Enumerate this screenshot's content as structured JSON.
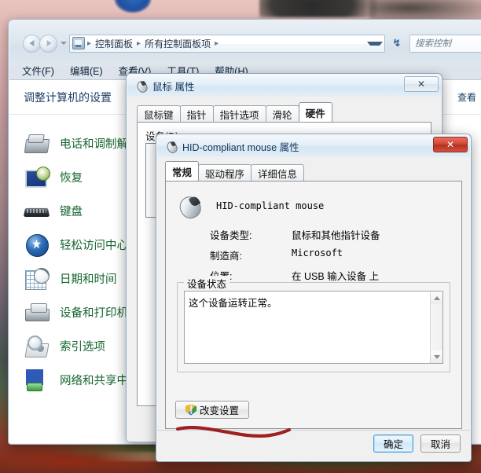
{
  "explorer": {
    "nav": {
      "back_icon": "back-arrow-icon",
      "forward_icon": "forward-arrow-icon",
      "recent_pages_icon": "chevron-down-icon",
      "address_icon": "control-panel-icon",
      "breadcrumbs": [
        "控制面板",
        "所有控制面板项"
      ],
      "breadcrumb_separator": "▸",
      "dropdown_icon": "chevron-down-icon",
      "refresh_icon": "refresh-icon",
      "refresh_glyph": "↯"
    },
    "search": {
      "placeholder": "搜索控制",
      "value": ""
    },
    "menu": [
      "文件(F)",
      "编辑(E)",
      "查看(V)",
      "工具(T)",
      "帮助(H)"
    ],
    "header": {
      "title": "调整计算机的设置",
      "view_by": "查看"
    },
    "items": [
      {
        "label": "电话和调制解",
        "icon": "phone-modem-icon"
      },
      {
        "label": "恢复",
        "icon": "recovery-icon"
      },
      {
        "label": "键盘",
        "icon": "keyboard-icon"
      },
      {
        "label": "轻松访问中心",
        "icon": "ease-of-access-icon"
      },
      {
        "label": "日期和时间",
        "icon": "date-time-icon"
      },
      {
        "label": "设备和打印机",
        "icon": "devices-printers-icon"
      },
      {
        "label": "索引选项",
        "icon": "indexing-options-icon"
      },
      {
        "label": "网络和共享中心",
        "icon": "network-sharing-icon"
      }
    ]
  },
  "mouse_properties": {
    "title": "鼠标 属性",
    "title_icon": "mouse-icon",
    "close_label": "✕",
    "tabs": [
      {
        "label": "鼠标键",
        "active": false
      },
      {
        "label": "指针",
        "active": false
      },
      {
        "label": "指针选项",
        "active": false
      },
      {
        "label": "滑轮",
        "active": false
      },
      {
        "label": "硬件",
        "active": true
      }
    ],
    "device_list_label": "设备(D):"
  },
  "hid_properties": {
    "title": "HID-compliant mouse 属性",
    "title_icon": "mouse-icon",
    "close_label": "✕",
    "tabs": [
      {
        "label": "常规",
        "active": true
      },
      {
        "label": "驱动程序",
        "active": false
      },
      {
        "label": "详细信息",
        "active": false
      }
    ],
    "device_name": "HID-compliant mouse",
    "device_icon": "mouse-icon",
    "info": [
      {
        "key": "设备类型:",
        "value": "鼠标和其他指针设备"
      },
      {
        "key": "制造商:",
        "value": "Microsoft"
      },
      {
        "key": "位置:",
        "value": "在 USB 输入设备 上"
      }
    ],
    "status_group_label": "设备状态",
    "status_text": "这个设备运转正常。",
    "scrollbar": {
      "up_icon": "scroll-up-icon",
      "down_icon": "scroll-down-icon"
    },
    "change_settings_button": {
      "label": "改变设置",
      "icon": "uac-shield-icon"
    },
    "ok_button": "确定",
    "cancel_button": "取消"
  },
  "annotation": {
    "type": "red-marker-stroke",
    "color": "#9e2020"
  },
  "colors": {
    "link_green": "#15652f",
    "window_chrome": "#dfe8f0",
    "title_text": "#13375c",
    "close_red": "#d14532",
    "default_button_blue": "#4c9fd6",
    "marker_red": "#9e2020"
  }
}
